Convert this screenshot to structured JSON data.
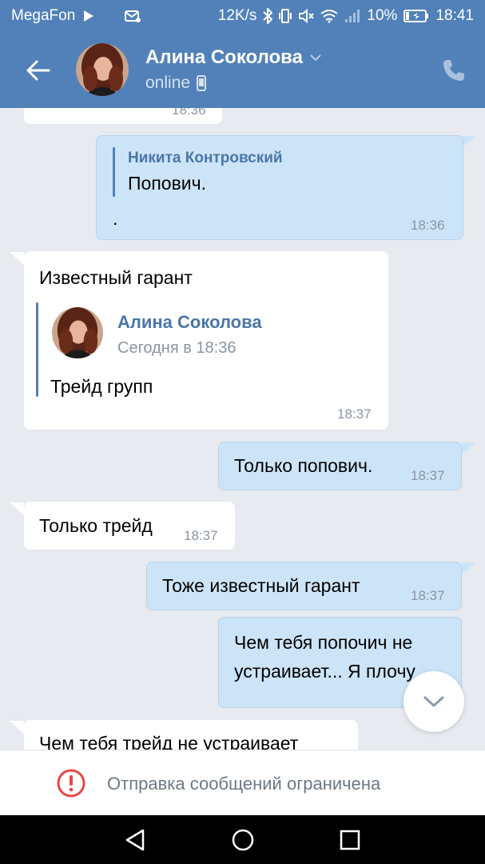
{
  "status_bar": {
    "carrier": "MegaFon",
    "speed": "12K/s",
    "battery": "10%",
    "time": "18:41"
  },
  "header": {
    "name": "Алина Соколова",
    "status": "online"
  },
  "messages": [
    {
      "time": "18:36"
    },
    {
      "forward_author": "Никита Контровский",
      "forward_text": "Попович.",
      "text": ".",
      "time": "18:36"
    },
    {
      "text": "Известный гарант",
      "forward_author": "Алина Соколова",
      "forward_date": "Сегодня в 18:36",
      "forward_text": "Трейд групп",
      "time": "18:37"
    },
    {
      "text": "Только попович.",
      "time": "18:37"
    },
    {
      "text": "Только трейд",
      "time": "18:37"
    },
    {
      "text": "Тоже известный гарант",
      "time": "18:37"
    },
    {
      "text_line1": "Чем тебя попочич не",
      "text_line2": "устраивает... Я плочу"
    },
    {
      "text": "Чем тебя трейд не устраивает"
    }
  ],
  "restriction": {
    "text": "Отправка сообщений ограничена"
  },
  "colors": {
    "brand": "#5181b8",
    "outgoing_bubble": "#cce4f7",
    "incoming_bubble": "#ffffff",
    "warning": "#e64646"
  }
}
